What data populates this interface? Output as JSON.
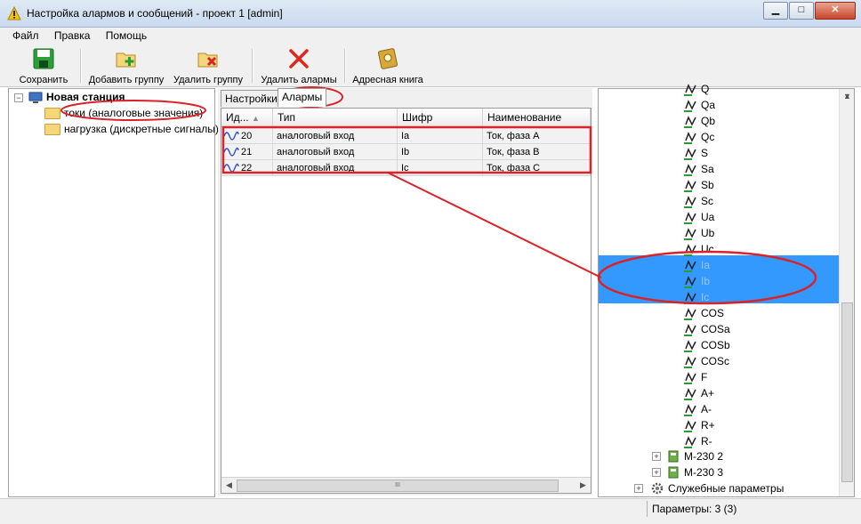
{
  "window": {
    "title": "Настройка алармов и сообщений - проект 1 [admin]"
  },
  "menu": [
    "Файл",
    "Правка",
    "Помощь"
  ],
  "toolbar": {
    "save": "Сохранить",
    "add_group": "Добавить группу",
    "delete_group": "Удалить группу",
    "delete_alarms": "Удалить алармы",
    "address_book": "Адресная книга"
  },
  "left_tree": {
    "root": "Новая станция",
    "groups": [
      "токи (аналоговые значения)",
      "нагрузка (дискретные сигналы)"
    ]
  },
  "tabs": [
    "Настройки",
    "Алармы"
  ],
  "grid": {
    "columns": [
      "Ид...",
      "Тип",
      "Шифр",
      "Наименование"
    ],
    "rows": [
      {
        "id": "20",
        "type": "аналоговый вход",
        "code": "Ia",
        "name": "Ток, фаза А"
      },
      {
        "id": "21",
        "type": "аналоговый вход",
        "code": "Ib",
        "name": "Ток, фаза В"
      },
      {
        "id": "22",
        "type": "аналоговый вход",
        "code": "Ic",
        "name": "Ток, фаза С"
      }
    ],
    "scroll_grip": "III"
  },
  "right_tree": {
    "signals": [
      "Q",
      "Qa",
      "Qb",
      "Qc",
      "S",
      "Sa",
      "Sb",
      "Sc",
      "Ua",
      "Ub",
      "Uc",
      "Ia",
      "Ib",
      "Ic",
      "COS",
      "COSa",
      "COSb",
      "COSc",
      "F",
      "A+",
      "A-",
      "R+",
      "R-"
    ],
    "devices": [
      "M-230 2",
      "M-230 3"
    ],
    "service": "Служебные параметры"
  },
  "status": {
    "params": "Параметры: 3 (3)"
  },
  "colors": {
    "selection": "#3399ff",
    "annotation": "#d8232a"
  }
}
